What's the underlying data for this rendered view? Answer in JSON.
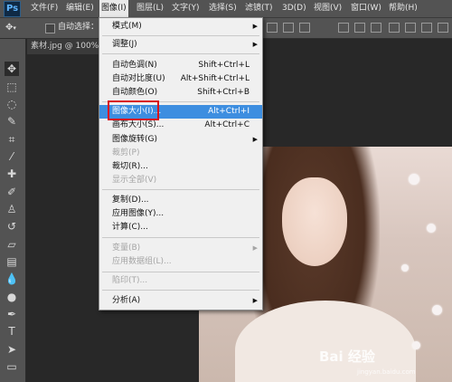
{
  "app": {
    "logo": "Ps"
  },
  "menubar": {
    "items": [
      {
        "label": "文件(F)"
      },
      {
        "label": "编辑(E)"
      },
      {
        "label": "图像(I)"
      },
      {
        "label": "图层(L)"
      },
      {
        "label": "文字(Y)"
      },
      {
        "label": "选择(S)"
      },
      {
        "label": "滤镜(T)"
      },
      {
        "label": "3D(D)"
      },
      {
        "label": "视图(V)"
      },
      {
        "label": "窗口(W)"
      },
      {
        "label": "帮助(H)"
      }
    ],
    "active_index": 2
  },
  "options_bar": {
    "auto_select_label": "自动选择：",
    "auto_select_checked": false
  },
  "document_tab": {
    "title": "素材.jpg @ 100%("
  },
  "image_menu": {
    "items": [
      {
        "label": "模式(M)",
        "shortcut": "",
        "submenu": true,
        "disabled": false
      },
      {
        "label": "调整(J)",
        "shortcut": "",
        "submenu": true,
        "disabled": false
      },
      {
        "label": "自动色调(N)",
        "shortcut": "Shift+Ctrl+L",
        "submenu": false,
        "disabled": false
      },
      {
        "label": "自动对比度(U)",
        "shortcut": "Alt+Shift+Ctrl+L",
        "submenu": false,
        "disabled": false
      },
      {
        "label": "自动颜色(O)",
        "shortcut": "Shift+Ctrl+B",
        "submenu": false,
        "disabled": false
      },
      {
        "label": "图像大小(I)...",
        "shortcut": "Alt+Ctrl+I",
        "submenu": false,
        "disabled": false,
        "highlighted": true
      },
      {
        "label": "画布大小(S)...",
        "shortcut": "Alt+Ctrl+C",
        "submenu": false,
        "disabled": false
      },
      {
        "label": "图像旋转(G)",
        "shortcut": "",
        "submenu": true,
        "disabled": false
      },
      {
        "label": "裁剪(P)",
        "shortcut": "",
        "submenu": false,
        "disabled": true
      },
      {
        "label": "裁切(R)...",
        "shortcut": "",
        "submenu": false,
        "disabled": false
      },
      {
        "label": "显示全部(V)",
        "shortcut": "",
        "submenu": false,
        "disabled": true
      },
      {
        "label": "复制(D)...",
        "shortcut": "",
        "submenu": false,
        "disabled": false
      },
      {
        "label": "应用图像(Y)...",
        "shortcut": "",
        "submenu": false,
        "disabled": false
      },
      {
        "label": "计算(C)...",
        "shortcut": "",
        "submenu": false,
        "disabled": false
      },
      {
        "label": "变量(B)",
        "shortcut": "",
        "submenu": true,
        "disabled": true
      },
      {
        "label": "应用数据组(L)...",
        "shortcut": "",
        "submenu": false,
        "disabled": true
      },
      {
        "label": "陷印(T)...",
        "shortcut": "",
        "submenu": false,
        "disabled": true
      },
      {
        "label": "分析(A)",
        "shortcut": "",
        "submenu": true,
        "disabled": false
      }
    ]
  },
  "watermark": {
    "text": "Bai 经验",
    "sub": "jingyan.baidu.com"
  },
  "colors": {
    "highlight": "#3d8ee0",
    "annotation": "#d8121b",
    "menubar": "#535353"
  }
}
